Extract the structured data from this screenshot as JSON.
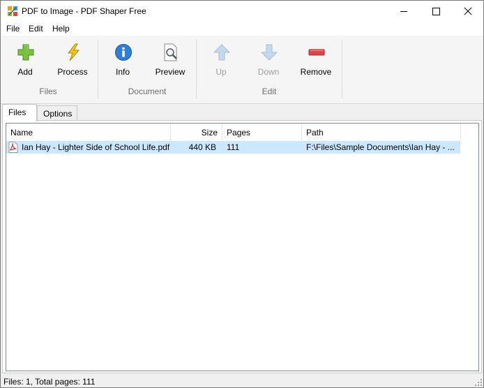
{
  "window": {
    "title": "PDF to Image - PDF Shaper Free"
  },
  "menu": [
    "File",
    "Edit",
    "Help"
  ],
  "ribbon": {
    "buttons": {
      "add": "Add",
      "process": "Process",
      "info": "Info",
      "preview": "Preview",
      "up": "Up",
      "down": "Down",
      "remove": "Remove"
    },
    "groups": {
      "files": "Files",
      "document": "Document",
      "edit": "Edit"
    },
    "disabled": [
      "up",
      "down"
    ]
  },
  "tabs": [
    {
      "label": "Files",
      "active": true
    },
    {
      "label": "Options",
      "active": false
    }
  ],
  "table": {
    "columns": [
      "Name",
      "Size",
      "Pages",
      "Path"
    ],
    "rows": [
      {
        "name": "Ian Hay - Lighter Side of School Life.pdf",
        "size": "440 KB",
        "pages": "111",
        "path": "F:\\Files\\Sample Documents\\Ian Hay - ...",
        "selected": true
      }
    ]
  },
  "status": {
    "text": "Files: 1, Total pages: 111"
  },
  "colors": {
    "selection": "#cce8ff",
    "ribbon_bg": "#f5f5f5",
    "disabled_text": "#a0a0a0",
    "add_icon": "#7cc142",
    "remove_icon": "#e04545",
    "info_icon": "#2e7fd9"
  },
  "icons": {
    "app": "app-icon",
    "add": "plus-icon",
    "process": "lightning-icon",
    "info": "info-icon",
    "preview": "magnifier-icon",
    "up": "arrow-up-icon",
    "down": "arrow-down-icon",
    "remove": "minus-icon",
    "file": "pdf-file-icon"
  }
}
